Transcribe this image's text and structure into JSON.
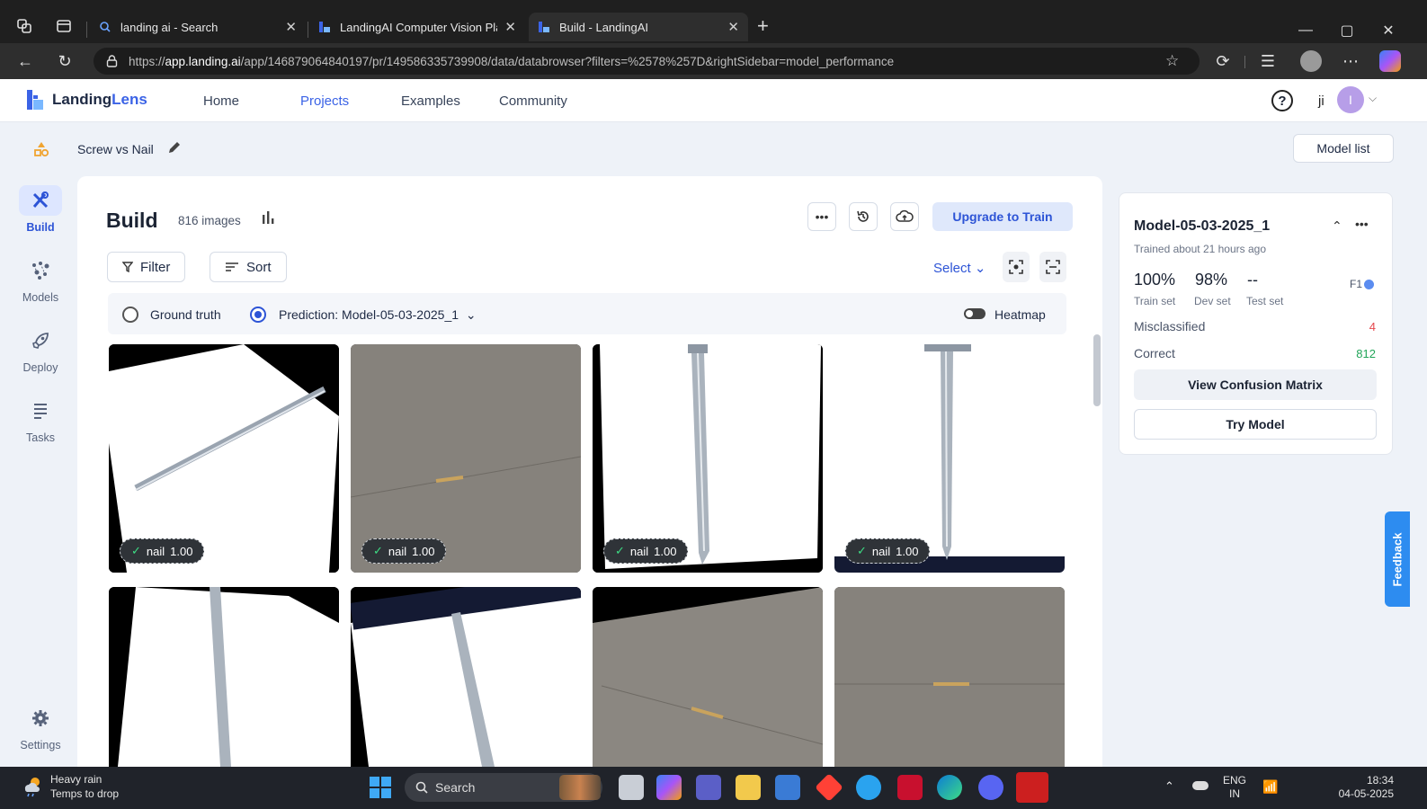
{
  "browser": {
    "tabs": [
      {
        "label": "landing ai - Search",
        "active": false
      },
      {
        "label": "LandingAI Computer Vision Platf",
        "active": false
      },
      {
        "label": "Build - LandingAI",
        "active": true
      }
    ],
    "url_prefix": "https://",
    "url_host": "app.landing.ai",
    "url_path": "/app/146879064840197/pr/149586335739908/data/databrowser?filters=%2578%257D&rightSidebar=model_performance"
  },
  "header": {
    "logo_part1": "Landing",
    "logo_part2": "Lens",
    "nav": [
      "Home",
      "Projects",
      "Examples",
      "Community"
    ],
    "active_nav": "Projects",
    "user_initials": "ji",
    "avatar_letter": "I"
  },
  "project": {
    "name": "Screw vs Nail",
    "model_list_label": "Model list"
  },
  "rail": [
    {
      "label": "Build",
      "icon": "tools-icon"
    },
    {
      "label": "Models",
      "icon": "models-icon"
    },
    {
      "label": "Deploy",
      "icon": "rocket-icon"
    },
    {
      "label": "Tasks",
      "icon": "tasks-icon"
    },
    {
      "label": "Settings",
      "icon": "gear-icon"
    }
  ],
  "build": {
    "title": "Build",
    "image_count": "816 images",
    "upgrade_label": "Upgrade to Train",
    "filter_label": "Filter",
    "sort_label": "Sort",
    "select_label": "Select",
    "ground_truth_label": "Ground truth",
    "prediction_label": "Prediction: Model-05-03-2025_1",
    "heatmap_label": "Heatmap",
    "thumbnails": [
      {
        "label": "nail",
        "score": "1.00"
      },
      {
        "label": "nail",
        "score": "1.00"
      },
      {
        "label": "nail",
        "score": "1.00"
      },
      {
        "label": "nail",
        "score": "1.00"
      }
    ]
  },
  "model_panel": {
    "name": "Model-05-03-2025_1",
    "trained": "Trained about 21 hours ago",
    "train_val": "100%",
    "dev_val": "98%",
    "test_val": "--",
    "train_lbl": "Train set",
    "dev_lbl": "Dev set",
    "test_lbl": "Test set",
    "metric": "F1",
    "misclassified_label": "Misclassified",
    "misclassified_value": "4",
    "correct_label": "Correct",
    "correct_value": "812",
    "confusion_label": "View Confusion Matrix",
    "try_label": "Try Model",
    "feedback_label": "Feedback"
  },
  "taskbar": {
    "weather_line1": "Heavy rain",
    "weather_line2": "Temps to drop",
    "search_label": "Search",
    "lang_line1": "ENG",
    "lang_line2": "IN",
    "time": "18:34",
    "date": "04-05-2025"
  },
  "colors": {
    "accent": "#3b63e6",
    "correct": "#22a559",
    "misclassified": "#e5484d"
  }
}
